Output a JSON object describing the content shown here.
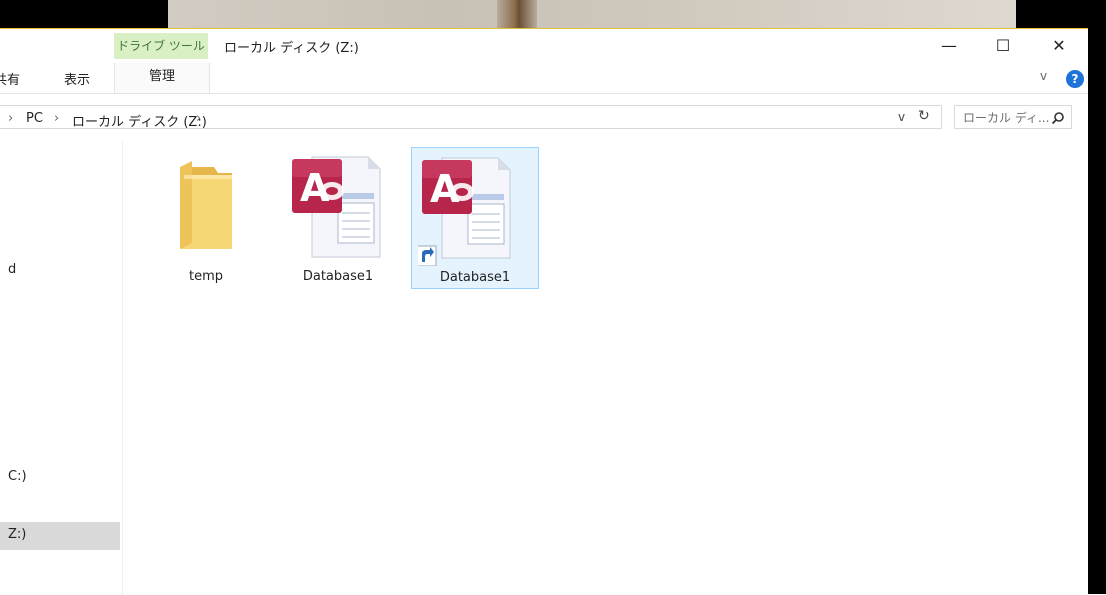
{
  "window": {
    "context_tab": "ドライブ ツール",
    "title": "ローカル ディスク (Z:)",
    "minimize": "—",
    "maximize": "☐",
    "close": "✕"
  },
  "ribbon": {
    "tabs": [
      "共有",
      "表示"
    ],
    "manage": "管理",
    "expand": "v",
    "help": "?"
  },
  "address": {
    "chevron": "›",
    "crumbs": [
      "PC",
      "ローカル ディスク (Z:)"
    ],
    "dropdown": "v",
    "refresh": "↻"
  },
  "search": {
    "placeholder": "ローカル ディ..."
  },
  "nav": {
    "items": [
      {
        "label": "d"
      },
      {
        "label": "C:)"
      },
      {
        "label": "Z:)"
      }
    ]
  },
  "files": [
    {
      "name": "temp",
      "type": "folder-icon"
    },
    {
      "name": "Database1",
      "type": "access-database-icon"
    },
    {
      "name": "Database1",
      "type": "access-database-shortcut-icon"
    }
  ],
  "colors": {
    "context_tab_bg": "#d8f0c4",
    "selection_bg": "#e5f3ff",
    "selection_border": "#99d1ff",
    "help_blue": "#1e73d8",
    "access_red": "#b7254b"
  }
}
